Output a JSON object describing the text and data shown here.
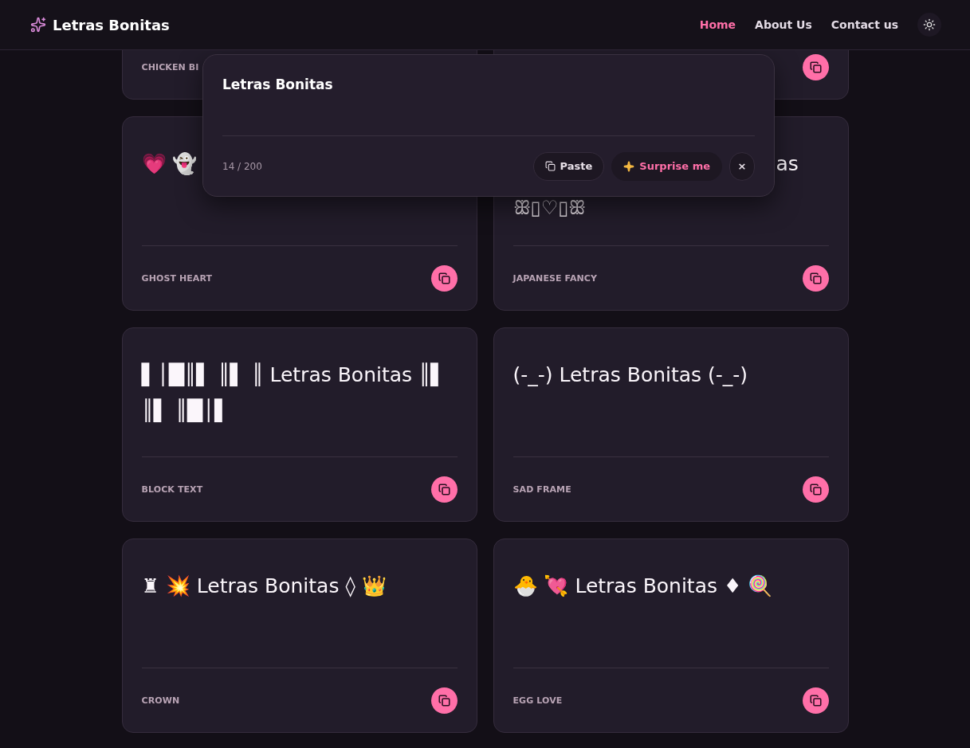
{
  "header": {
    "brand": "Letras Bonitas",
    "nav": [
      {
        "label": "Home",
        "selected": true
      },
      {
        "label": "About Us",
        "selected": false
      },
      {
        "label": "Contact us",
        "selected": false
      }
    ]
  },
  "cards": [
    {
      "kind": "label_only",
      "label": "CHICKEN BI"
    },
    {
      "kind": "button_only"
    },
    {
      "kind": "full",
      "text": "💗 👻",
      "label": "GHOST HEART"
    },
    {
      "kind": "covered",
      "tail": "as",
      "text": "ꕥ▯♡▯ꕥ",
      "label": "JAPANESE FANCY"
    },
    {
      "kind": "full",
      "text": "▌│█║▌ ║▌ ║ Letras Bonitas ║▌ ║▌ ║█│▌",
      "label": "BLOCK TEXT"
    },
    {
      "kind": "full",
      "text": "(-_-) Letras Bonitas (-_-)",
      "label": "SAD FRAME"
    },
    {
      "kind": "full",
      "text": "♜ 💥 Letras Bonitas ◊ 👑",
      "label": "CROWN"
    },
    {
      "kind": "full",
      "text": "🐣 💘 Letras Bonitas ♦ 🍭",
      "label": "EGG LOVE"
    }
  ],
  "editor": {
    "value": "Letras Bonitas",
    "count": "14 / 200",
    "buttons": [
      {
        "kind": "paste",
        "label": "Paste"
      },
      {
        "kind": "surprise",
        "label": "Surprise me"
      },
      {
        "kind": "clear",
        "label": "×"
      }
    ]
  }
}
